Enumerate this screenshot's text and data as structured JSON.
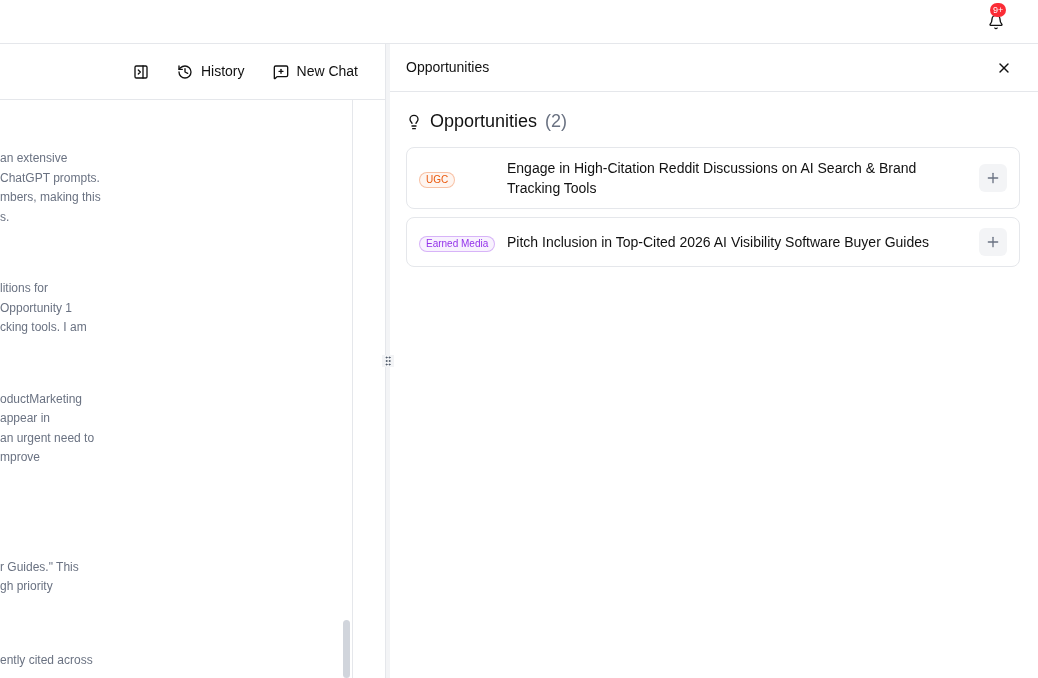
{
  "notifications": {
    "badge": "9+"
  },
  "chat": {
    "toolbar": [
      {
        "kind": "panel"
      },
      {
        "kind": "history",
        "label": "History"
      },
      {
        "kind": "new",
        "label": "New Chat"
      }
    ],
    "paragraphs": [
      [
        "an extensive",
        "ChatGPT prompts.",
        "mbers, making this",
        "s."
      ],
      [
        "litions for",
        "Opportunity 1",
        "cking tools. I am"
      ],
      [
        "oductMarketing",
        "appear in",
        "an urgent need to",
        "mprove"
      ],
      [
        "r Guides.\" This",
        "gh priority"
      ],
      [
        "ently cited across"
      ]
    ]
  },
  "panel": {
    "title": "Opportunities",
    "heading": "Opportunities",
    "count": "(2)",
    "items": [
      {
        "tag": "UGC",
        "color": "#ea580c",
        "title": "Engage in High-Citation Reddit Discussions on AI Search & Brand Tracking Tools"
      },
      {
        "tag": "Earned Media",
        "color": "#9333ea",
        "title": "Pitch Inclusion in Top-Cited 2026 AI Visibility Software Buyer Guides"
      }
    ]
  }
}
